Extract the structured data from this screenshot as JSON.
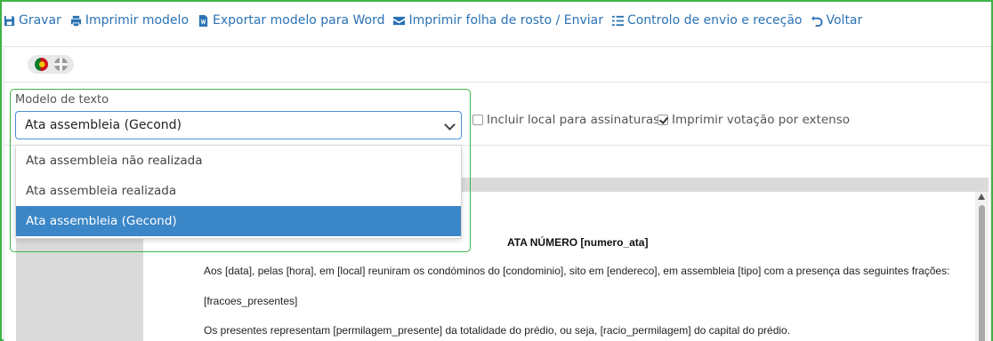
{
  "toolbar": {
    "items": [
      {
        "label": "Gravar",
        "icon": "save-icon"
      },
      {
        "label": "Imprimir modelo",
        "icon": "print-icon"
      },
      {
        "label": "Exportar modelo para Word",
        "icon": "word-file-icon"
      },
      {
        "label": "Imprimir folha de rosto / Enviar",
        "icon": "envelope-icon"
      },
      {
        "label": "Controlo de envio e receção",
        "icon": "list-icon"
      },
      {
        "label": "Voltar",
        "icon": "undo-icon"
      }
    ],
    "color": "#2a72b5"
  },
  "languages": [
    {
      "name": "flag-portugal-icon"
    },
    {
      "name": "flag-uk-icon"
    }
  ],
  "template_select": {
    "label": "Modelo de texto",
    "value": "Ata assembleia (Gecond)",
    "options": [
      "Ata assembleia não realizada",
      "Ata assembleia realizada",
      "Ata assembleia (Gecond)"
    ],
    "selected_index": 2
  },
  "options": {
    "include_signature_place": {
      "label": "Incluir local para assinaturas",
      "checked": false
    },
    "print_vote_in_words": {
      "label": "Imprimir votação por extenso",
      "checked": true
    }
  },
  "document": {
    "title": "ATA NÚMERO [numero_ata]",
    "paragraphs": [
      "Aos [data], pelas [hora], em [local] reuniram os condóminos do [condominio], sito em [endereco], em assembleia [tipo] com a presença das seguintes frações:",
      "[fracoes_presentes]",
      "Os presentes representam [permilagem_presente] da totalidade do prédio, ou seja, [racio_permilagem] do capital do prédio."
    ]
  },
  "colors": {
    "highlight_border": "#3fb24a",
    "selected_option": "#3b86c6",
    "select_border": "#4b8fd8"
  }
}
